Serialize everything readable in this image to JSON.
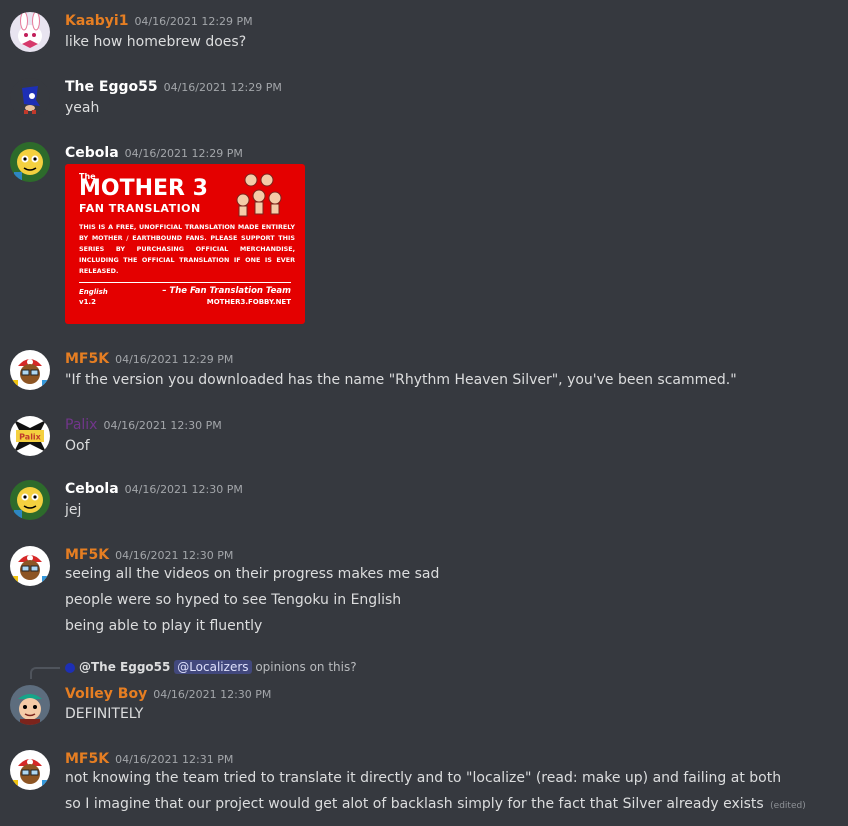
{
  "colors": {
    "background": "#36393f",
    "orange_name": "#e67e22",
    "white_name": "#ffffff",
    "purple_name": "#71368a",
    "mention_bg": "#5865f2"
  },
  "messages": [
    {
      "id": "m1",
      "author": "Kaabyi1",
      "timestamp": "04/16/2021 12:29 PM",
      "lines": [
        "like how homebrew does?"
      ]
    },
    {
      "id": "m2",
      "author": "The Eggo55",
      "timestamp": "04/16/2021 12:29 PM",
      "lines": [
        "yeah"
      ]
    },
    {
      "id": "m3",
      "author": "Cebola",
      "timestamp": "04/16/2021 12:29 PM",
      "lines": [],
      "embed": {
        "the": "The",
        "title": "MOTHER 3",
        "subtitle": "FAN TRANSLATION",
        "body": "THIS IS A FREE, UNOFFICIAL TRANSLATION MADE ENTIRELY BY MOTHER / EARTHBOUND FANS. PLEASE SUPPORT THIS SERIES BY PURCHASING OFFICIAL MERCHANDISE, INCLUDING THE OFFICIAL TRANSLATION IF ONE IS EVER RELEASED.",
        "language": "English",
        "version": "v1.2",
        "team": "– The Fan Translation Team",
        "site": "MOTHER3.FOBBY.NET"
      }
    },
    {
      "id": "m4",
      "author": "MF5K",
      "timestamp": "04/16/2021 12:29 PM",
      "lines": [
        "\"If the version you downloaded has the name \"Rhythm Heaven Silver\", you've been scammed.\""
      ]
    },
    {
      "id": "m5",
      "author": "Palix",
      "timestamp": "04/16/2021 12:30 PM",
      "lines": [
        "Oof"
      ],
      "avatar_text": "Palix"
    },
    {
      "id": "m6",
      "author": "Cebola",
      "timestamp": "04/16/2021 12:30 PM",
      "lines": [
        "jej"
      ]
    },
    {
      "id": "m7",
      "author": "MF5K",
      "timestamp": "04/16/2021 12:30 PM",
      "lines": [
        "seeing all the videos on their progress makes me sad",
        "people were so hyped to see Tengoku in English",
        "being able to play it fluently"
      ]
    },
    {
      "id": "m8",
      "author": "Volley Boy",
      "timestamp": "04/16/2021 12:30 PM",
      "lines": [
        "DEFINITELY"
      ],
      "reply": {
        "author": "@The Eggo55",
        "mention": "@Localizers",
        "text": "opinions on this?"
      }
    },
    {
      "id": "m9",
      "author": "MF5K",
      "timestamp": "04/16/2021 12:31 PM",
      "lines": [
        "not knowing the team tried to translate it directly and to \"localize\" (read: make up) and failing at both",
        "so I imagine that our project would get alot of backlash simply for the fact that Silver already exists"
      ],
      "edited": "(edited)"
    }
  ]
}
